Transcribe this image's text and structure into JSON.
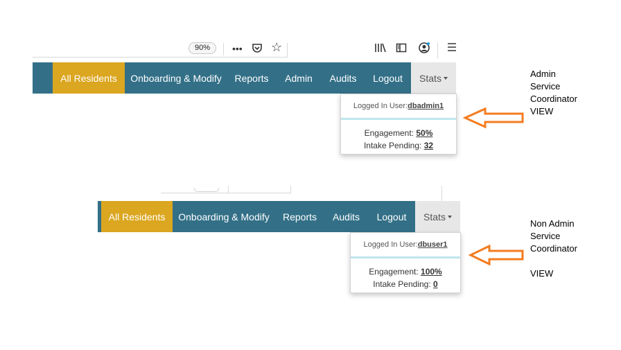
{
  "browser_toolbar": {
    "zoom_level": "90%",
    "icons": [
      "more-icon",
      "pocket-icon",
      "bookmark-star-icon",
      "library-icon",
      "sidebar-icon",
      "account-icon",
      "menu-icon"
    ]
  },
  "admin_view": {
    "nav": {
      "items": [
        {
          "label": "All Residents",
          "active": true
        },
        {
          "label": "Onboarding & Modify"
        },
        {
          "label": "Reports"
        },
        {
          "label": "Admin"
        },
        {
          "label": "Audits"
        },
        {
          "label": "Logout"
        }
      ],
      "stats_label": "Stats"
    },
    "dropdown": {
      "logged_in_label": "Logged In User:",
      "user": "dbadmin1",
      "engagement_label": "Engagement:",
      "engagement_value": "50%",
      "intake_label": "Intake Pending:",
      "intake_value": "32"
    },
    "annotation": [
      "Admin",
      "Service",
      "Coordinator",
      "VIEW"
    ]
  },
  "user_view": {
    "nav": {
      "items": [
        {
          "label": "All Residents",
          "active": true
        },
        {
          "label": "Onboarding & Modify"
        },
        {
          "label": "Reports"
        },
        {
          "label": "Audits"
        },
        {
          "label": "Logout"
        }
      ],
      "stats_label": "Stats"
    },
    "dropdown": {
      "logged_in_label": "Logged In User:",
      "user": "dbuser1",
      "engagement_label": "Engagement:",
      "engagement_value": "100%",
      "intake_label": "Intake Pending:",
      "intake_value": "0"
    },
    "annotation": [
      "Non Admin",
      "Service",
      "Coordinator",
      "",
      "VIEW"
    ]
  },
  "colors": {
    "nav_bg": "#337088",
    "active_bg": "#dba620",
    "stats_bg": "#e7e7e7",
    "arrow": "#f47c20"
  }
}
